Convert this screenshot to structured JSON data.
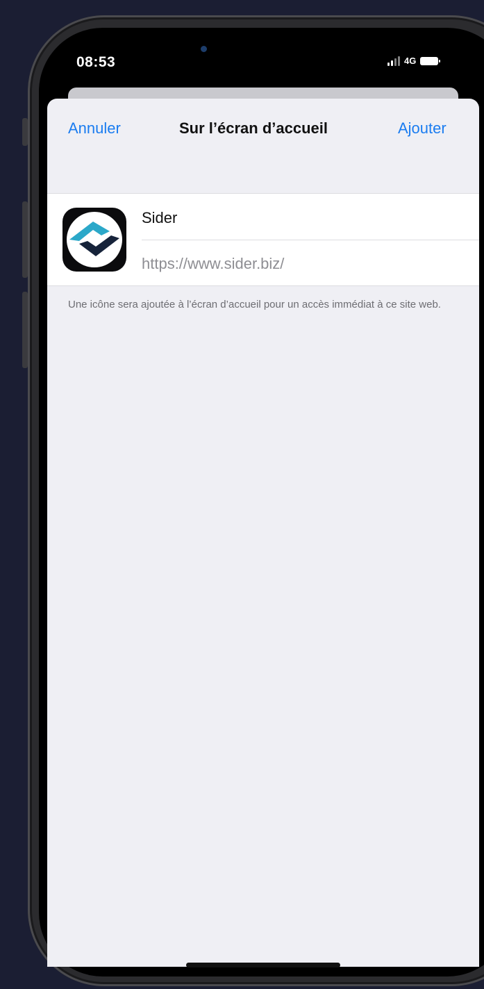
{
  "status_bar": {
    "time": "08:53",
    "network": "4G"
  },
  "nav": {
    "cancel_label": "Annuler",
    "title": "Sur l’écran d’accueil",
    "add_label": "Ajouter"
  },
  "shortcut": {
    "name": "Sider",
    "url": "https://www.sider.biz/"
  },
  "footnote": "Une icône sera ajoutée à l’écran d’accueil pour un accès immédiat à ce site web.",
  "colors": {
    "accent": "#1a7cf0",
    "background": "#1b1e33",
    "sheet": "#efeff4",
    "icon_teal": "#2ba8c9",
    "icon_dark": "#16233a"
  }
}
